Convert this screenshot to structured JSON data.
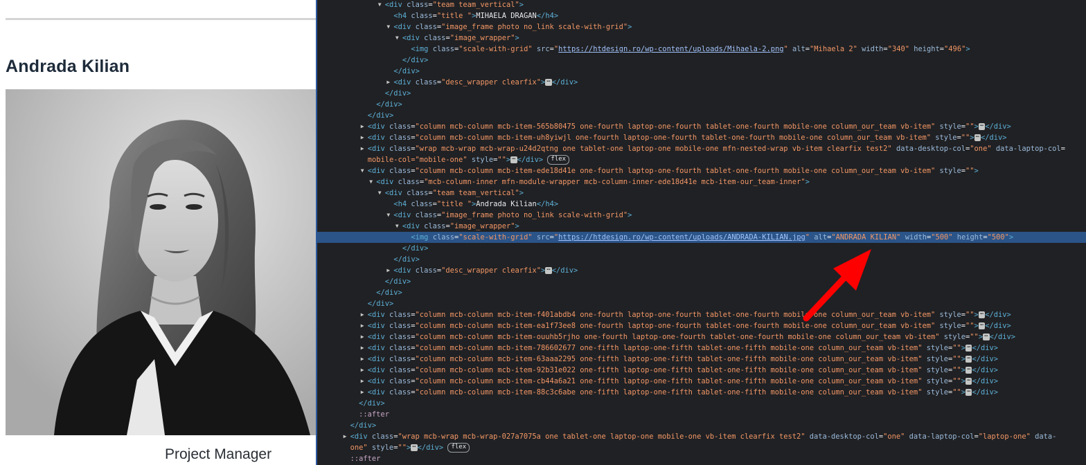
{
  "page": {
    "member_name": "Andrada Kilian",
    "member_role": "Project Manager"
  },
  "devtools": {
    "lines": [
      {
        "indent": 14,
        "tri": "down",
        "html": "<span class='tag'>&lt;div</span> <span class='aname'>class</span><span class='txt'>=</span><span class='aval'>\"team team_vertical\"</span><span class='tag'>&gt;</span>"
      },
      {
        "indent": 16,
        "tri": "",
        "html": "<span class='tag'>&lt;h4</span> <span class='aname'>class</span><span class='txt'>=</span><span class='aval'>\"title \"</span><span class='tag'>&gt;</span><span class='txt'>MIHAELA DRAGAN</span><span class='tag'>&lt;/h4&gt;</span>"
      },
      {
        "indent": 16,
        "tri": "down",
        "html": "<span class='tag'>&lt;div</span> <span class='aname'>class</span><span class='txt'>=</span><span class='aval'>\"image_frame photo no_link scale-with-grid\"</span><span class='tag'>&gt;</span>"
      },
      {
        "indent": 18,
        "tri": "down",
        "html": "<span class='tag'>&lt;div</span> <span class='aname'>class</span><span class='txt'>=</span><span class='aval'>\"image_wrapper\"</span><span class='tag'>&gt;</span>"
      },
      {
        "indent": 20,
        "tri": "",
        "html": "<span class='tag'>&lt;img</span> <span class='aname'>class</span><span class='txt'>=</span><span class='aval'>\"scale-with-grid\"</span> <span class='aname'>src</span><span class='txt'>=</span><span class='aval'>\"</span><span class='url'>https://htdesign.ro/wp-content/uploads/Mihaela-2.png</span><span class='aval'>\"</span> <span class='aname'>alt</span><span class='txt'>=</span><span class='aval'>\"Mihaela 2\"</span> <span class='aname'>width</span><span class='txt'>=</span><span class='aval'>\"340\"</span> <span class='aname'>height</span><span class='txt'>=</span><span class='aval'>\"496\"</span><span class='tag'>&gt;</span>"
      },
      {
        "indent": 18,
        "tri": "",
        "html": "<span class='tag'>&lt;/div&gt;</span>"
      },
      {
        "indent": 16,
        "tri": "",
        "html": "<span class='tag'>&lt;/div&gt;</span>"
      },
      {
        "indent": 16,
        "tri": "right",
        "html": "<span class='tag'>&lt;div</span> <span class='aname'>class</span><span class='txt'>=</span><span class='aval'>\"desc_wrapper clearfix\"</span><span class='tag'>&gt;</span><span class='ell'>&#8943;</span><span class='tag'>&lt;/div&gt;</span>"
      },
      {
        "indent": 14,
        "tri": "",
        "html": "<span class='tag'>&lt;/div&gt;</span>"
      },
      {
        "indent": 12,
        "tri": "",
        "html": "<span class='tag'>&lt;/div&gt;</span>"
      },
      {
        "indent": 10,
        "tri": "",
        "html": "<span class='tag'>&lt;/div&gt;</span>"
      },
      {
        "indent": 10,
        "tri": "right",
        "html": "<span class='tag'>&lt;div</span> <span class='aname'>class</span><span class='txt'>=</span><span class='aval'>\"column mcb-column mcb-item-565b80475 one-fourth laptop-one-fourth tablet-one-fourth mobile-one column_our_team vb-item\"</span> <span class='aname'>style</span><span class='txt'>=</span><span class='aval'>\"\"</span><span class='tag'>&gt;</span><span class='ell'>&#8943;</span><span class='tag'>&lt;/div&gt;</span>"
      },
      {
        "indent": 10,
        "tri": "right",
        "html": "<span class='tag'>&lt;div</span> <span class='aname'>class</span><span class='txt'>=</span><span class='aval'>\"column mcb-column mcb-item-uh8yiwjl one-fourth laptop-one-fourth tablet-one-fourth mobile-one column_our_team vb-item\"</span> <span class='aname'>style</span><span class='txt'>=</span><span class='aval'>\"\"</span><span class='tag'>&gt;</span><span class='ell'>&#8943;</span><span class='tag'>&lt;/div&gt;</span>"
      },
      {
        "indent": 10,
        "tri": "right",
        "html": "<span class='tag'>&lt;div</span> <span class='aname'>class</span><span class='txt'>=</span><span class='aval'>\"wrap mcb-wrap mcb-wrap-u24d2qtng one tablet-one laptop-one mobile-one mfn-nested-wrap vb-item clearfix test2\"</span> <span class='aname'>data-desktop-col</span><span class='txt'>=</span><span class='aval'>\"one\"</span> <span class='aname'>data-laptop-col</span><span class='txt'>=</span>"
      },
      {
        "indent": 10,
        "tri": "",
        "html": "<span class='aval'>mobile-col=\"mobile-one\"</span> <span class='aname'>style</span><span class='txt'>=</span><span class='aval'>\"\"</span><span class='tag'>&gt;</span><span class='ell'>&#8943;</span><span class='tag'>&lt;/div&gt;</span> <span class='badge'>flex</span>"
      },
      {
        "indent": 10,
        "tri": "down",
        "html": "<span class='tag'>&lt;div</span> <span class='aname'>class</span><span class='txt'>=</span><span class='aval'>\"column mcb-column mcb-item-ede18d41e one-fourth laptop-one-fourth tablet-one-fourth mobile-one column_our_team vb-item\"</span> <span class='aname'>style</span><span class='txt'>=</span><span class='aval'>\"\"</span><span class='tag'>&gt;</span>"
      },
      {
        "indent": 12,
        "tri": "down",
        "html": "<span class='tag'>&lt;div</span> <span class='aname'>class</span><span class='txt'>=</span><span class='aval'>\"mcb-column-inner mfn-module-wrapper mcb-column-inner-ede18d41e mcb-item-our_team-inner\"</span><span class='tag'>&gt;</span>"
      },
      {
        "indent": 14,
        "tri": "down",
        "html": "<span class='tag'>&lt;div</span> <span class='aname'>class</span><span class='txt'>=</span><span class='aval'>\"team team_vertical\"</span><span class='tag'>&gt;</span>"
      },
      {
        "indent": 16,
        "tri": "",
        "html": "<span class='tag'>&lt;h4</span> <span class='aname'>class</span><span class='txt'>=</span><span class='aval'>\"title \"</span><span class='tag'>&gt;</span><span class='txt'>Andrada Kilian</span><span class='tag'>&lt;/h4&gt;</span>"
      },
      {
        "indent": 16,
        "tri": "down",
        "html": "<span class='tag'>&lt;div</span> <span class='aname'>class</span><span class='txt'>=</span><span class='aval'>\"image_frame photo no_link scale-with-grid\"</span><span class='tag'>&gt;</span>"
      },
      {
        "indent": 18,
        "tri": "down",
        "html": "<span class='tag'>&lt;div</span> <span class='aname'>class</span><span class='txt'>=</span><span class='aval'>\"image_wrapper\"</span><span class='tag'>&gt;</span>"
      },
      {
        "indent": 20,
        "tri": "",
        "selected": true,
        "html": "<span class='tag'>&lt;img</span> <span class='aname'>class</span><span class='txt'>=</span><span class='aval'>\"scale-with-grid\"</span> <span class='aname'>src</span><span class='txt'>=</span><span class='aval'>\"</span><span class='url'>https://htdesign.ro/wp-content/uploads/ANDRADA-KILIAN.jpg</span><span class='aval'>\"</span> <span class='aname'>alt</span><span class='txt'>=</span><span class='aval'>\"ANDRADA KILIAN\"</span> <span class='aname'>width</span><span class='txt'>=</span><span class='aval'>\"500\"</span> <span class='aname'>height</span><span class='txt'>=</span><span class='aval'>\"500\"</span><span class='tag'>&gt;</span>"
      },
      {
        "indent": 18,
        "tri": "",
        "html": "<span class='tag'>&lt;/div&gt;</span>"
      },
      {
        "indent": 16,
        "tri": "",
        "html": "<span class='tag'>&lt;/div&gt;</span>"
      },
      {
        "indent": 16,
        "tri": "right",
        "html": "<span class='tag'>&lt;div</span> <span class='aname'>class</span><span class='txt'>=</span><span class='aval'>\"desc_wrapper clearfix\"</span><span class='tag'>&gt;</span><span class='ell'>&#8943;</span><span class='tag'>&lt;/div&gt;</span>"
      },
      {
        "indent": 14,
        "tri": "",
        "html": "<span class='tag'>&lt;/div&gt;</span>"
      },
      {
        "indent": 12,
        "tri": "",
        "html": "<span class='tag'>&lt;/div&gt;</span>"
      },
      {
        "indent": 10,
        "tri": "",
        "html": "<span class='tag'>&lt;/div&gt;</span>"
      },
      {
        "indent": 10,
        "tri": "right",
        "html": "<span class='tag'>&lt;div</span> <span class='aname'>class</span><span class='txt'>=</span><span class='aval'>\"column mcb-column mcb-item-f401abdb4 one-fourth laptop-one-fourth tablet-one-fourth mobile-one column_our_team vb-item\"</span> <span class='aname'>style</span><span class='txt'>=</span><span class='aval'>\"\"</span><span class='tag'>&gt;</span><span class='ell'>&#8943;</span><span class='tag'>&lt;/div&gt;</span>"
      },
      {
        "indent": 10,
        "tri": "right",
        "html": "<span class='tag'>&lt;div</span> <span class='aname'>class</span><span class='txt'>=</span><span class='aval'>\"column mcb-column mcb-item-ea1f73ee8 one-fourth laptop-one-fourth tablet-one-fourth mobile-one column_our_team vb-item\"</span> <span class='aname'>style</span><span class='txt'>=</span><span class='aval'>\"\"</span><span class='tag'>&gt;</span><span class='ell'>&#8943;</span><span class='tag'>&lt;/div&gt;</span>"
      },
      {
        "indent": 10,
        "tri": "right",
        "html": "<span class='tag'>&lt;div</span> <span class='aname'>class</span><span class='txt'>=</span><span class='aval'>\"column mcb-column mcb-item-ouuhb5rjho one-fourth laptop-one-fourth tablet-one-fourth mobile-one column_our_team vb-item\"</span> <span class='aname'>style</span><span class='txt'>=</span><span class='aval'>\"\"</span><span class='tag'>&gt;</span><span class='ell'>&#8943;</span><span class='tag'>&lt;/div&gt;</span>"
      },
      {
        "indent": 10,
        "tri": "right",
        "html": "<span class='tag'>&lt;div</span> <span class='aname'>class</span><span class='txt'>=</span><span class='aval'>\"column mcb-column mcb-item-786602677 one-fifth laptop-one-fifth tablet-one-fifth mobile-one column_our_team vb-item\"</span> <span class='aname'>style</span><span class='txt'>=</span><span class='aval'>\"\"</span><span class='tag'>&gt;</span><span class='ell'>&#8943;</span><span class='tag'>&lt;/div&gt;</span>"
      },
      {
        "indent": 10,
        "tri": "right",
        "html": "<span class='tag'>&lt;div</span> <span class='aname'>class</span><span class='txt'>=</span><span class='aval'>\"column mcb-column mcb-item-63aaa2295 one-fifth laptop-one-fifth tablet-one-fifth mobile-one column_our_team vb-item\"</span> <span class='aname'>style</span><span class='txt'>=</span><span class='aval'>\"\"</span><span class='tag'>&gt;</span><span class='ell'>&#8943;</span><span class='tag'>&lt;/div&gt;</span>"
      },
      {
        "indent": 10,
        "tri": "right",
        "html": "<span class='tag'>&lt;div</span> <span class='aname'>class</span><span class='txt'>=</span><span class='aval'>\"column mcb-column mcb-item-92b31e022 one-fifth laptop-one-fifth tablet-one-fifth mobile-one column_our_team vb-item\"</span> <span class='aname'>style</span><span class='txt'>=</span><span class='aval'>\"\"</span><span class='tag'>&gt;</span><span class='ell'>&#8943;</span><span class='tag'>&lt;/div&gt;</span>"
      },
      {
        "indent": 10,
        "tri": "right",
        "html": "<span class='tag'>&lt;div</span> <span class='aname'>class</span><span class='txt'>=</span><span class='aval'>\"column mcb-column mcb-item-cb44a6a21 one-fifth laptop-one-fifth tablet-one-fifth mobile-one column_our_team vb-item\"</span> <span class='aname'>style</span><span class='txt'>=</span><span class='aval'>\"\"</span><span class='tag'>&gt;</span><span class='ell'>&#8943;</span><span class='tag'>&lt;/div&gt;</span>"
      },
      {
        "indent": 10,
        "tri": "right",
        "html": "<span class='tag'>&lt;div</span> <span class='aname'>class</span><span class='txt'>=</span><span class='aval'>\"column mcb-column mcb-item-88c3c6abe one-fifth laptop-one-fifth tablet-one-fifth mobile-one column_our_team vb-item\"</span> <span class='aname'>style</span><span class='txt'>=</span><span class='aval'>\"\"</span><span class='tag'>&gt;</span><span class='ell'>&#8943;</span><span class='tag'>&lt;/div&gt;</span>"
      },
      {
        "indent": 8,
        "tri": "",
        "html": "<span class='tag'>&lt;/div&gt;</span>"
      },
      {
        "indent": 8,
        "tri": "",
        "html": "<span class='pseudo'>::after</span>"
      },
      {
        "indent": 6,
        "tri": "",
        "html": "<span class='tag'>&lt;/div&gt;</span>"
      },
      {
        "indent": 6,
        "tri": "right",
        "html": "<span class='tag'>&lt;div</span> <span class='aname'>class</span><span class='txt'>=</span><span class='aval'>\"wrap mcb-wrap mcb-wrap-027a7075a one tablet-one laptop-one mobile-one vb-item clearfix test2\"</span> <span class='aname'>data-desktop-col</span><span class='txt'>=</span><span class='aval'>\"one\"</span> <span class='aname'>data-laptop-col</span><span class='txt'>=</span><span class='aval'>\"laptop-one\"</span> <span class='aname'>data-</span>"
      },
      {
        "indent": 6,
        "tri": "",
        "html": "<span class='aval'>one\"</span> <span class='aname'>style</span><span class='txt'>=</span><span class='aval'>\"\"</span><span class='tag'>&gt;</span><span class='ell'>&#8943;</span><span class='tag'>&lt;/div&gt;</span> <span class='badge'>flex</span>"
      },
      {
        "indent": 6,
        "tri": "",
        "html": "<span class='pseudo'>::after</span>"
      }
    ]
  }
}
